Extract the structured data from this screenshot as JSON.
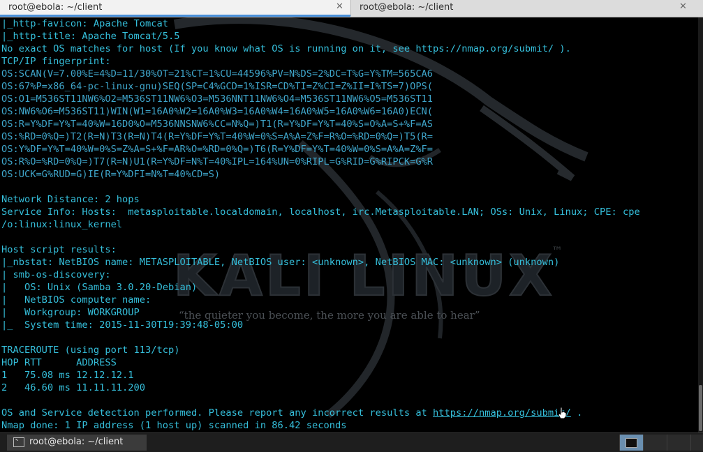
{
  "tabs": [
    {
      "label": "root@ebola: ~/client",
      "active": true
    },
    {
      "label": "root@ebola: ~/client",
      "active": false
    }
  ],
  "tab_close_glyph": "✕",
  "wallpaper": {
    "brand": "KALI LINUX",
    "trademark": "™",
    "tagline": "“the quieter you become, the more you are able to hear”"
  },
  "terminal_lines": [
    "|_http-favicon: Apache Tomcat",
    "|_http-title: Apache Tomcat/5.5",
    "No exact OS matches for host (If you know what OS is running on it, see https://nmap.org/submit/ ).",
    "TCP/IP fingerprint:",
    "OS:SCAN(V=7.00%E=4%D=11/30%OT=21%CT=1%CU=44596%PV=N%DS=2%DC=T%G=Y%TM=565CA6",
    "OS:67%P=x86_64-pc-linux-gnu)SEQ(SP=C4%GCD=1%ISR=CD%TI=Z%CI=Z%II=I%TS=7)OPS(",
    "OS:O1=M536ST11NW6%O2=M536ST11NW6%O3=M536NNT11NW6%O4=M536ST11NW6%O5=M536ST11",
    "OS:NW6%O6=M536ST11)WIN(W1=16A0%W2=16A0%W3=16A0%W4=16A0%W5=16A0%W6=16A0)ECN(",
    "OS:R=Y%DF=Y%T=40%W=16D0%O=M536NNSNW6%CC=N%Q=)T1(R=Y%DF=Y%T=40%S=O%A=S+%F=AS",
    "OS:%RD=0%Q=)T2(R=N)T3(R=N)T4(R=Y%DF=Y%T=40%W=0%S=A%A=Z%F=R%O=%RD=0%Q=)T5(R=",
    "OS:Y%DF=Y%T=40%W=0%S=Z%A=S+%F=AR%O=%RD=0%Q=)T6(R=Y%DF=Y%T=40%W=0%S=A%A=Z%F=",
    "OS:R%O=%RD=0%Q=)T7(R=N)U1(R=Y%DF=N%T=40%IPL=164%UN=0%RIPL=G%RID=G%RIPCK=G%R",
    "OS:UCK=G%RUD=G)IE(R=Y%DFI=N%T=40%CD=S)",
    "",
    "Network Distance: 2 hops",
    "Service Info: Hosts:  metasploitable.localdomain, localhost, irc.Metasploitable.LAN; OSs: Unix, Linux; CPE: cpe",
    "/o:linux:linux_kernel",
    "",
    "Host script results:",
    "|_nbstat: NetBIOS name: METASPLOITABLE, NetBIOS user: <unknown>, NetBIOS MAC: <unknown> (unknown)",
    "| smb-os-discovery:",
    "|   OS: Unix (Samba 3.0.20-Debian)",
    "|   NetBIOS computer name:",
    "|   Workgroup: WORKGROUP",
    "|_  System time: 2015-11-30T19:39:48-05:00",
    "",
    "TRACEROUTE (using port 113/tcp)",
    "HOP RTT      ADDRESS",
    "1   75.08 ms 12.12.12.1",
    "2   46.60 ms 11.11.11.200",
    "",
    "OS and Service detection performed. Please report any incorrect results at ",
    "Nmap done: 1 IP address (1 host up) scanned in 86.42 seconds"
  ],
  "report_link": "https://nmap.org/submit/",
  "report_tail": " .",
  "taskbar": {
    "window_label": "root@ebola: ~/client"
  },
  "colors": {
    "terminal_text": "#35bfdb",
    "background": "#000000",
    "tab_accent": "#4a90d9"
  }
}
